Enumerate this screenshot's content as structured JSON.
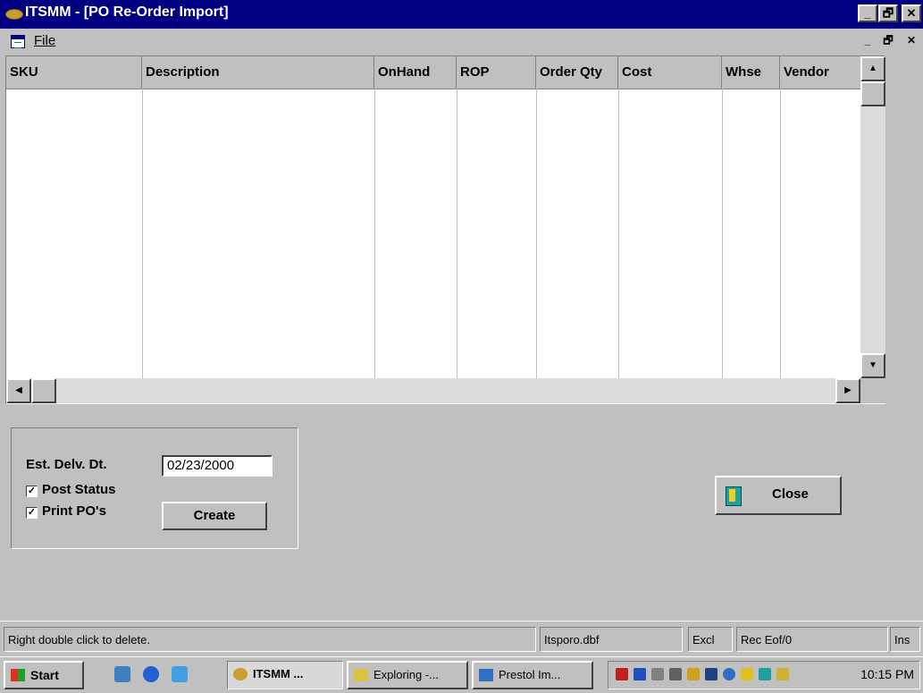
{
  "window": {
    "title": "ITSMM - [PO Re-Order Import]",
    "min_glyph": "_",
    "restore_glyph": "🗗",
    "close_glyph": "✕"
  },
  "menu": {
    "file": "File"
  },
  "grid": {
    "columns": [
      "SKU",
      "Description",
      "OnHand",
      "ROP",
      "Order Qty",
      "Cost",
      "Whse",
      "Vendor"
    ],
    "rows": []
  },
  "form": {
    "est_delv_label": "Est. Delv. Dt.",
    "est_delv_value": "02/23/2000",
    "post_status_label": "Post Status",
    "post_status_checked": true,
    "print_pos_label": "Print PO's",
    "print_pos_checked": true,
    "create_label": "Create",
    "close_label": "Close"
  },
  "status": {
    "hint": "Right double click to delete.",
    "file": "Itsporo.dbf",
    "mode": "Excl",
    "rec": "Rec Eof/0",
    "ins": "Ins"
  },
  "taskbar": {
    "start": "Start",
    "buttons": [
      "ITSMM ...",
      "Exploring -...",
      "Prestol Im..."
    ],
    "clock": "10:15 PM"
  },
  "colors": {
    "titlebar": "#000080",
    "face": "#c0c0c0"
  }
}
